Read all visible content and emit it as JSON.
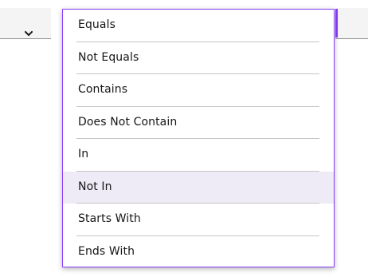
{
  "left_select": {
    "icon": "chevron-down-icon"
  },
  "dropdown": {
    "hovered_index": 5,
    "accent_color": "#8a3ffc",
    "hover_color": "#eeeaf6",
    "items": [
      {
        "label": "Equals"
      },
      {
        "label": "Not Equals"
      },
      {
        "label": "Contains"
      },
      {
        "label": "Does Not Contain"
      },
      {
        "label": "In"
      },
      {
        "label": "Not In"
      },
      {
        "label": "Starts With"
      },
      {
        "label": "Ends With"
      }
    ]
  }
}
